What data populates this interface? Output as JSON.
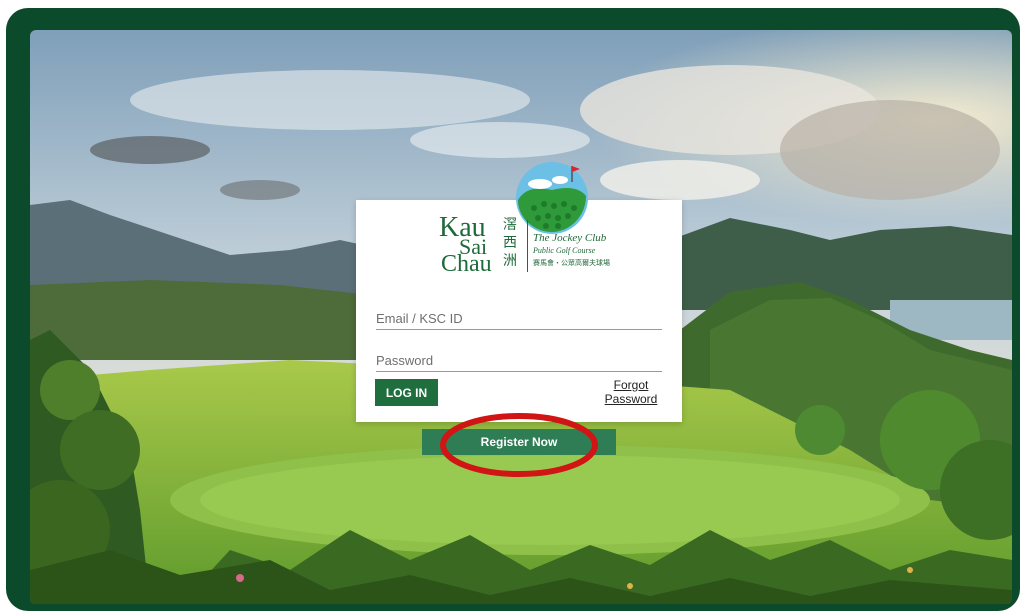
{
  "brand": {
    "name_line1": "Kau",
    "name_line2": "Sai",
    "name_line3": "Chau",
    "name_cn1": "滘",
    "name_cn2": "西",
    "name_cn3": "洲",
    "subtitle1": "The Jockey Club",
    "subtitle2": "Public Golf Course",
    "subtitle_cn": "賽馬會・公眾高爾夫球場"
  },
  "login_form": {
    "email_placeholder": "Email / KSC ID",
    "password_placeholder": "Password",
    "login_label": "LOG IN",
    "forgot_line1": "Forgot",
    "forgot_line2": "Password"
  },
  "register_label": "Register Now",
  "colors": {
    "frame": "#0b4a2a",
    "primary_button": "#1f6e3e",
    "register_button": "#2f7d55",
    "highlight_ring": "#d11414"
  }
}
